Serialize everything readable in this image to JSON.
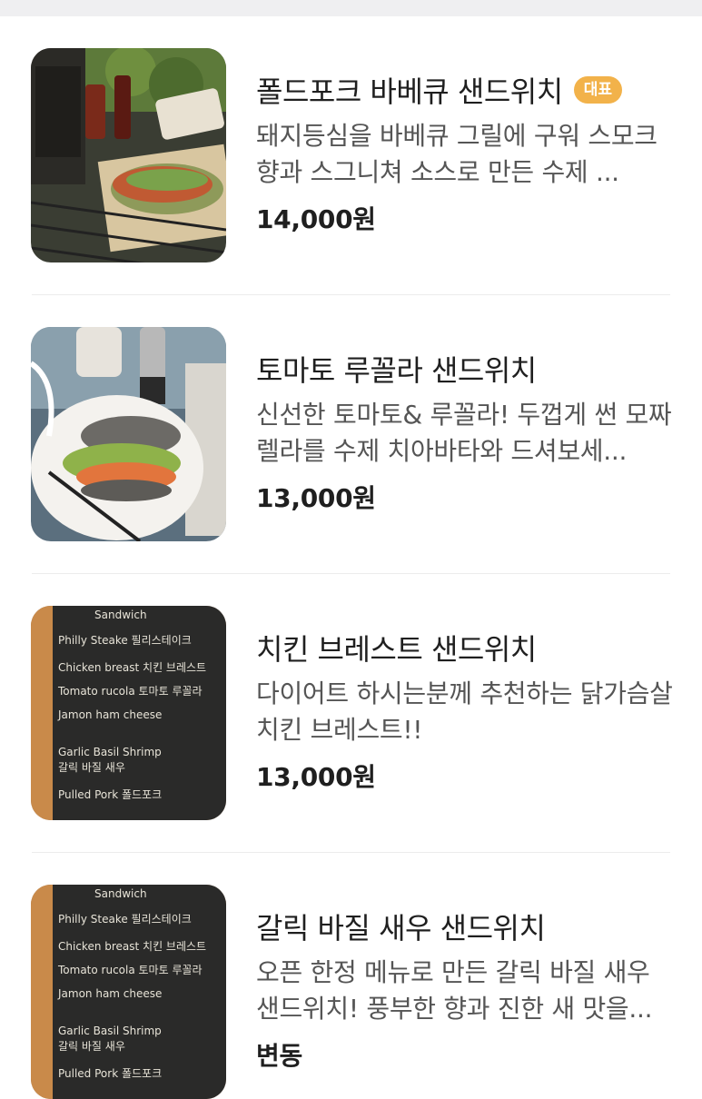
{
  "menu_items": [
    {
      "name": "폴드포크 바베큐 샌드위치",
      "badge": "대표",
      "description": "돼지등심을 바베큐 그릴에 구워 스모크 향과 스그니쳐 소스로 만든 수제 ...",
      "price": "14,000원",
      "image": "bbq-pulled-pork-sandwich-photo"
    },
    {
      "name": "토마토 루꼴라 샌드위치",
      "description": "신선한 토마토& 루꼴라! 두껍게 썬 모짜렐라를 수제 치아바타와 드셔보세...",
      "price": "13,000원",
      "image": "tomato-rucola-sandwich-photo"
    },
    {
      "name": "치킨 브레스트 샌드위치",
      "description": "다이어트 하시는분께 추천하는 닭가슴살 치킨 브레스트!!",
      "price": "13,000원",
      "image": "chalkboard-menu-photo"
    },
    {
      "name": "갈릭 바질 새우 샌드위치",
      "description": "오픈 한정 메뉴로 만든 갈릭 바질 새우 샌드위치! 풍부한 향과 진한 새 맛을...",
      "price": "변동",
      "image": "chalkboard-menu-photo"
    }
  ],
  "chalkboard": {
    "heading": "Sandwich",
    "lines": [
      "Philly Steake 필리스테이크",
      "Chicken breast 치킨 브레스트",
      "Tomato rucola 토마토 루꼴라",
      "Jamon ham cheese",
      "Garlic Basil Shrimp",
      "갈릭 바질 새우",
      "Pulled Pork 폴드포크"
    ]
  },
  "colors": {
    "badge": "#f2b24a",
    "title": "#1f1f1f",
    "description": "#555555",
    "divider": "#ececec",
    "top_band": "#efeff1"
  }
}
